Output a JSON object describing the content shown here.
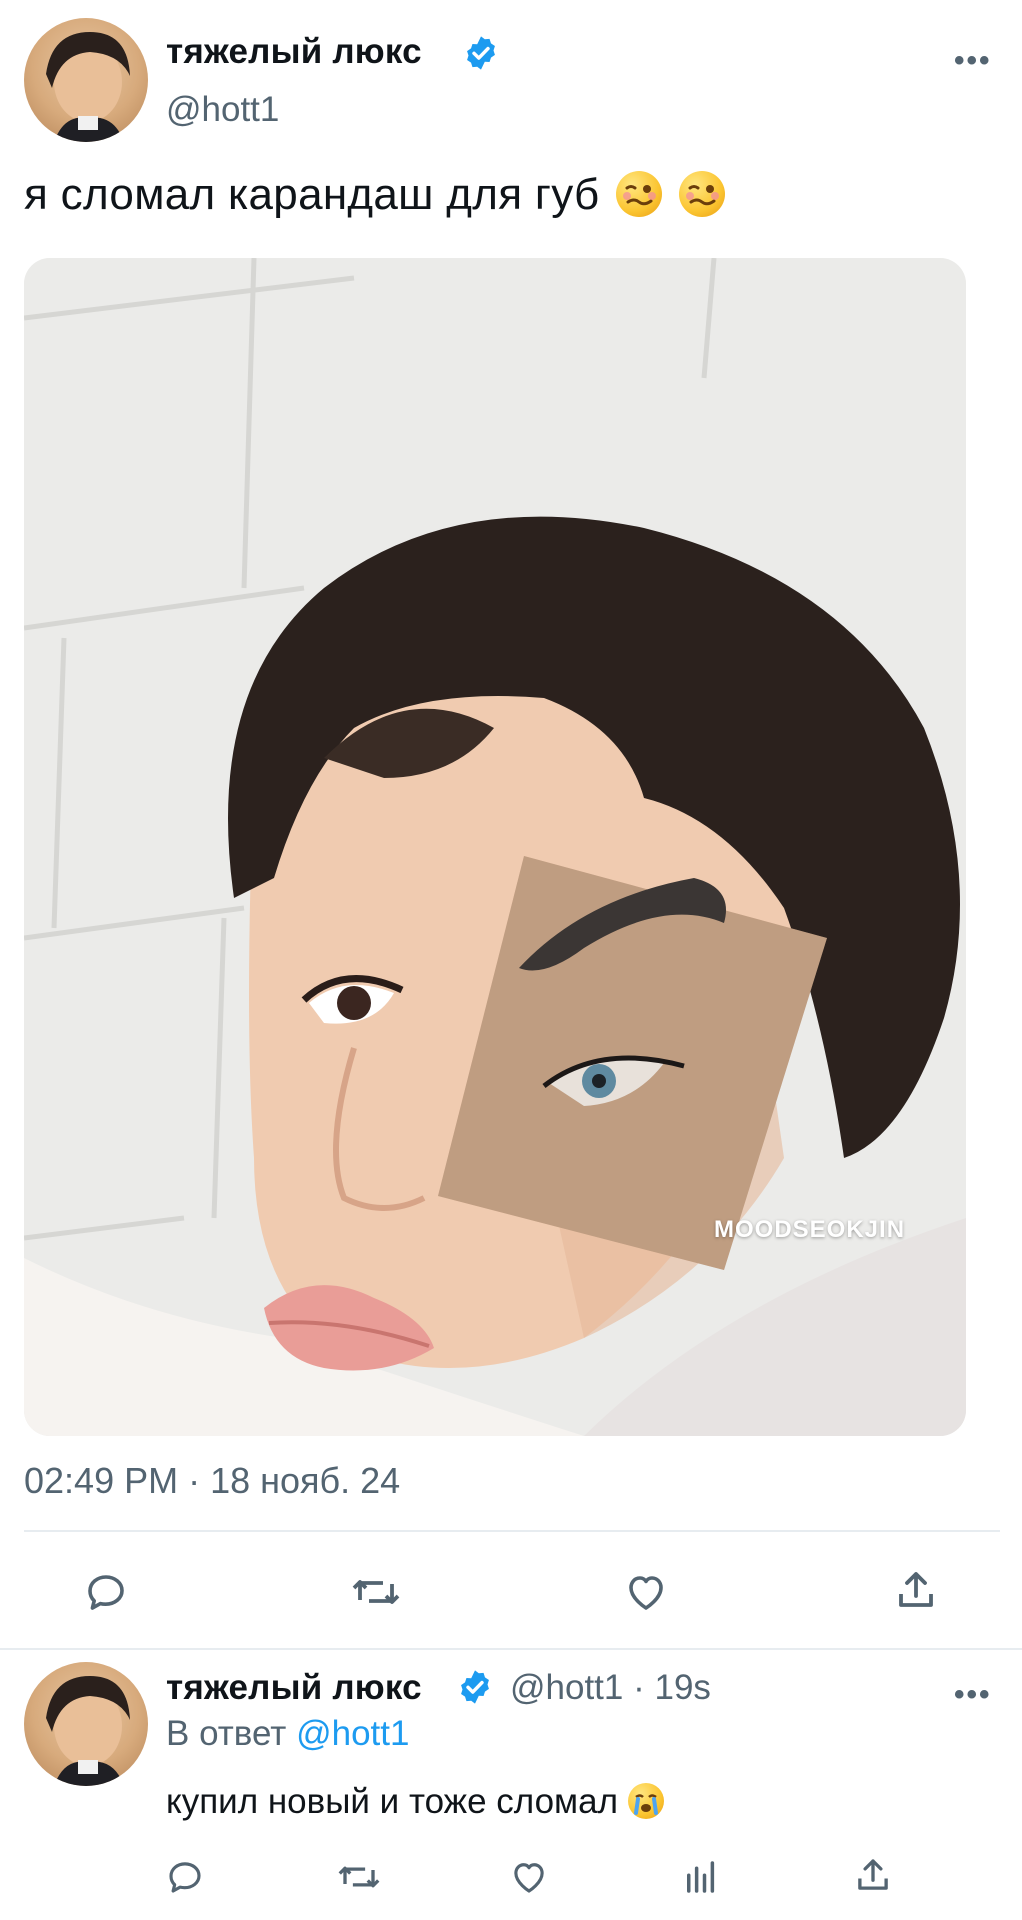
{
  "tweet": {
    "author_name": "тяжелый люкс",
    "handle": "@hott1",
    "more_label": "•••",
    "text": "я сломал карандаш для губ",
    "emoji": [
      "woozy-face",
      "woozy-face"
    ],
    "media_watermark": "MOODSEOKJIN",
    "timestamp": "02:49 PM · 18 нояб. 24"
  },
  "reply": {
    "author_name": "тяжелый люкс",
    "handle_time": "@hott1 · 19s",
    "more_label": "•••",
    "reply_prefix": "В ответ",
    "reply_to": "@hott1",
    "text": "купил новый и тоже сломал",
    "emoji": "loudly-crying-face"
  },
  "colors": {
    "verified": "#1d9bf0",
    "link": "#1d9bf0",
    "secondary_text": "#536471",
    "icon": "#536471"
  }
}
